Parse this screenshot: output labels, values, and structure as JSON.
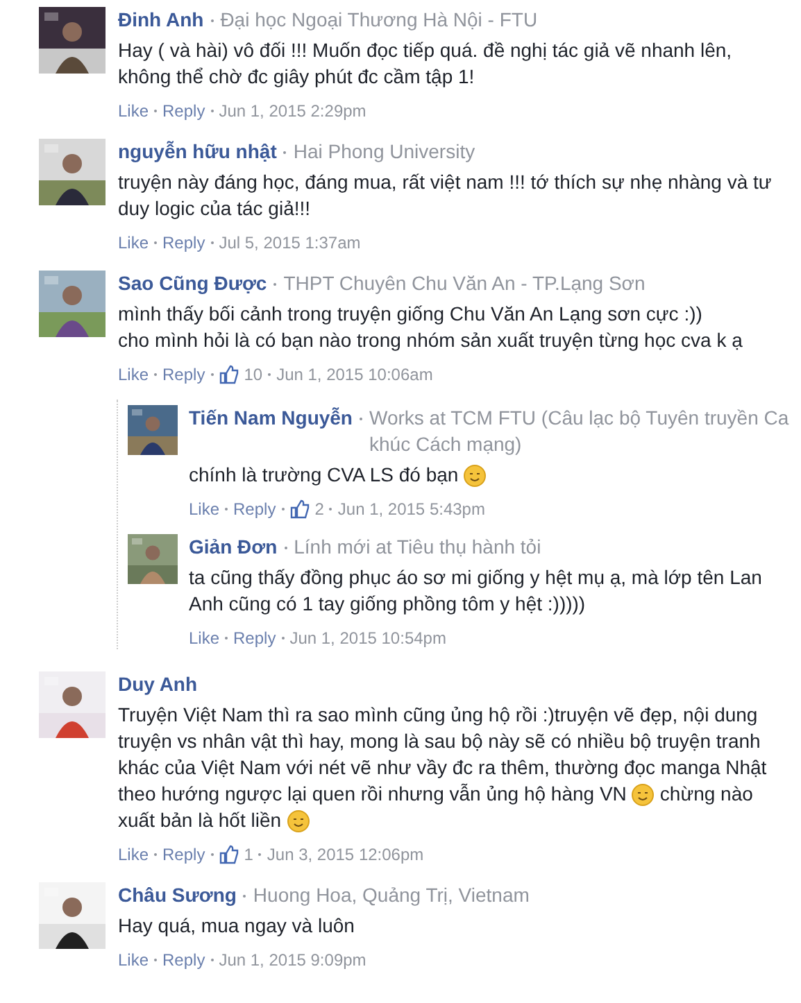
{
  "comments": [
    {
      "name": "Đinh Anh",
      "meta": "Đại học Ngoại Thương Hà Nội - FTU",
      "lines": [
        [
          {
            "kind": "text",
            "text": "Hay ( và hài) vô đối !!! Muốn đọc tiếp quá. đề nghị tác giả vẽ nhanh lên,"
          }
        ],
        [
          {
            "kind": "text",
            "text": "không thể chờ đc giây phút đc cầm tập 1!"
          }
        ]
      ],
      "actions": [
        "Like",
        "Reply"
      ],
      "date": "Jun 1, 2015 2:29pm"
    },
    {
      "name": "nguyễn hữu nhật",
      "meta": "Hai Phong University",
      "lines": [
        [
          {
            "kind": "text",
            "text": "truyện này đáng học, đáng mua, rất việt nam !!! tớ thích sự nhẹ nhàng và tư"
          }
        ],
        [
          {
            "kind": "text",
            "text": "duy logic của tác giả!!!"
          }
        ]
      ],
      "actions": [
        "Like",
        "Reply"
      ],
      "date": "Jul 5, 2015 1:37am"
    },
    {
      "name": "Sao Cũng Được",
      "meta": "THPT Chuyên Chu Văn An - TP.Lạng Sơn",
      "lines": [
        [
          {
            "kind": "text",
            "text": "mình thấy bối cảnh trong truyện giống Chu Văn An Lạng sơn cực :))"
          }
        ],
        [
          {
            "kind": "text",
            "text": "cho mình hỏi là có bạn nào trong nhóm sản xuất truyện từng học cva k ạ"
          }
        ]
      ],
      "actions": [
        "Like",
        "Reply"
      ],
      "likes": "10",
      "date": "Jun 1, 2015 10:06am",
      "replies": [
        {
          "name": "Tiến Nam Nguyễn",
          "meta": "Works at TCM FTU (Câu lạc bộ Tuyên truyền Ca khúc Cách mạng)",
          "lines": [
            [
              {
                "kind": "text",
                "text": "chính là trường CVA LS đó bạn"
              },
              {
                "kind": "emoji"
              }
            ]
          ],
          "actions": [
            "Like",
            "Reply"
          ],
          "likes": "2",
          "date": "Jun 1, 2015 5:43pm"
        },
        {
          "name": "Giản Đơn",
          "meta": "Lính mới at Tiêu thụ hành tỏi",
          "lines": [
            [
              {
                "kind": "text",
                "text": "ta cũng thấy đồng phục áo sơ mi giống y hệt mụ ạ, mà lớp tên Lan"
              }
            ],
            [
              {
                "kind": "text",
                "text": "Anh cũng có 1 tay giống phồng tôm y hệt :)))))"
              }
            ]
          ],
          "actions": [
            "Like",
            "Reply"
          ],
          "date": "Jun 1, 2015 10:54pm"
        }
      ]
    },
    {
      "name": "Duy Anh",
      "lines": [
        [
          {
            "kind": "text",
            "text": "Truyện Việt Nam thì ra sao mình cũng ủng hộ rồi :)truyện vẽ đẹp, nội dung"
          }
        ],
        [
          {
            "kind": "text",
            "text": "truyện vs nhân vật thì hay, mong là sau bộ này sẽ có nhiều bộ truyện tranh"
          }
        ],
        [
          {
            "kind": "text",
            "text": "khác của Việt Nam với nét vẽ như vầy đc ra thêm, thường đọc manga Nhật"
          }
        ],
        [
          {
            "kind": "text",
            "text": "theo hướng ngược lại quen rồi nhưng vẫn ủng hộ hàng VN"
          },
          {
            "kind": "emoji"
          },
          {
            "kind": "text",
            "text": "chừng nào"
          }
        ],
        [
          {
            "kind": "text",
            "text": "xuất bản là hốt liền"
          },
          {
            "kind": "emoji"
          }
        ]
      ],
      "actions": [
        "Like",
        "Reply"
      ],
      "likes": "1",
      "date": "Jun 3, 2015 12:06pm"
    },
    {
      "name": "Châu Sương",
      "meta": "Huong Hoa, Quảng Trị, Vietnam",
      "lines": [
        [
          {
            "kind": "text",
            "text": "Hay quá, mua ngay và luôn"
          }
        ]
      ],
      "actions": [
        "Like",
        "Reply"
      ],
      "date": "Jun 1, 2015 9:09pm"
    }
  ]
}
